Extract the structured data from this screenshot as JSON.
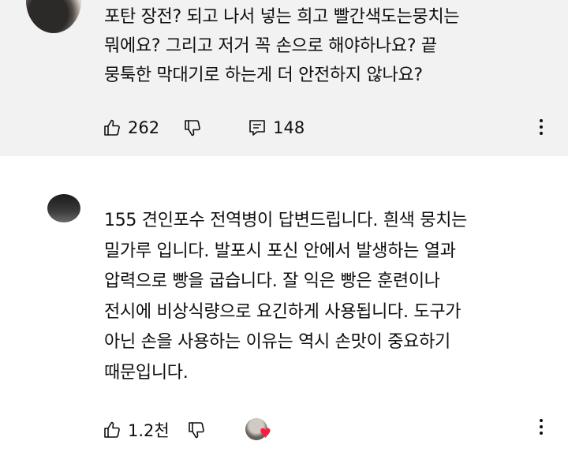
{
  "comments": [
    {
      "lines": [
        "포탄 장전? 되고 나서 넣는 희고 빨간색도는뭉치는",
        "뭐에요? 그리고 저거 꼭 손으로 해야하나요? 끝",
        "뭉툭한 막대기로 하는게 더 안전하지 않나요?"
      ],
      "likes": "262",
      "replies": "148"
    },
    {
      "lines": [
        "155 견인포수 전역병이 답변드립니다. 흰색 뭉치는",
        "밀가루 입니다. 발포시 포신 안에서 발생하는 열과",
        "압력으로 빵을 굽습니다. 잘 익은 빵은 훈련이나",
        "전시에 비상식량으로 요긴하게 사용됩니다. 도구가",
        "아닌 손을 사용하는 이유는 역시 손맛이 중요하기",
        "때문입니다."
      ],
      "likes": "1.2천"
    }
  ],
  "icons": {
    "like": "thumb-up-icon",
    "dislike": "thumb-down-icon",
    "reply": "reply-icon",
    "more": "more-vert-icon",
    "heart": "heart-icon"
  },
  "colors": {
    "card_bg": "#f2f2f2",
    "heart": "#ff1a3c"
  }
}
